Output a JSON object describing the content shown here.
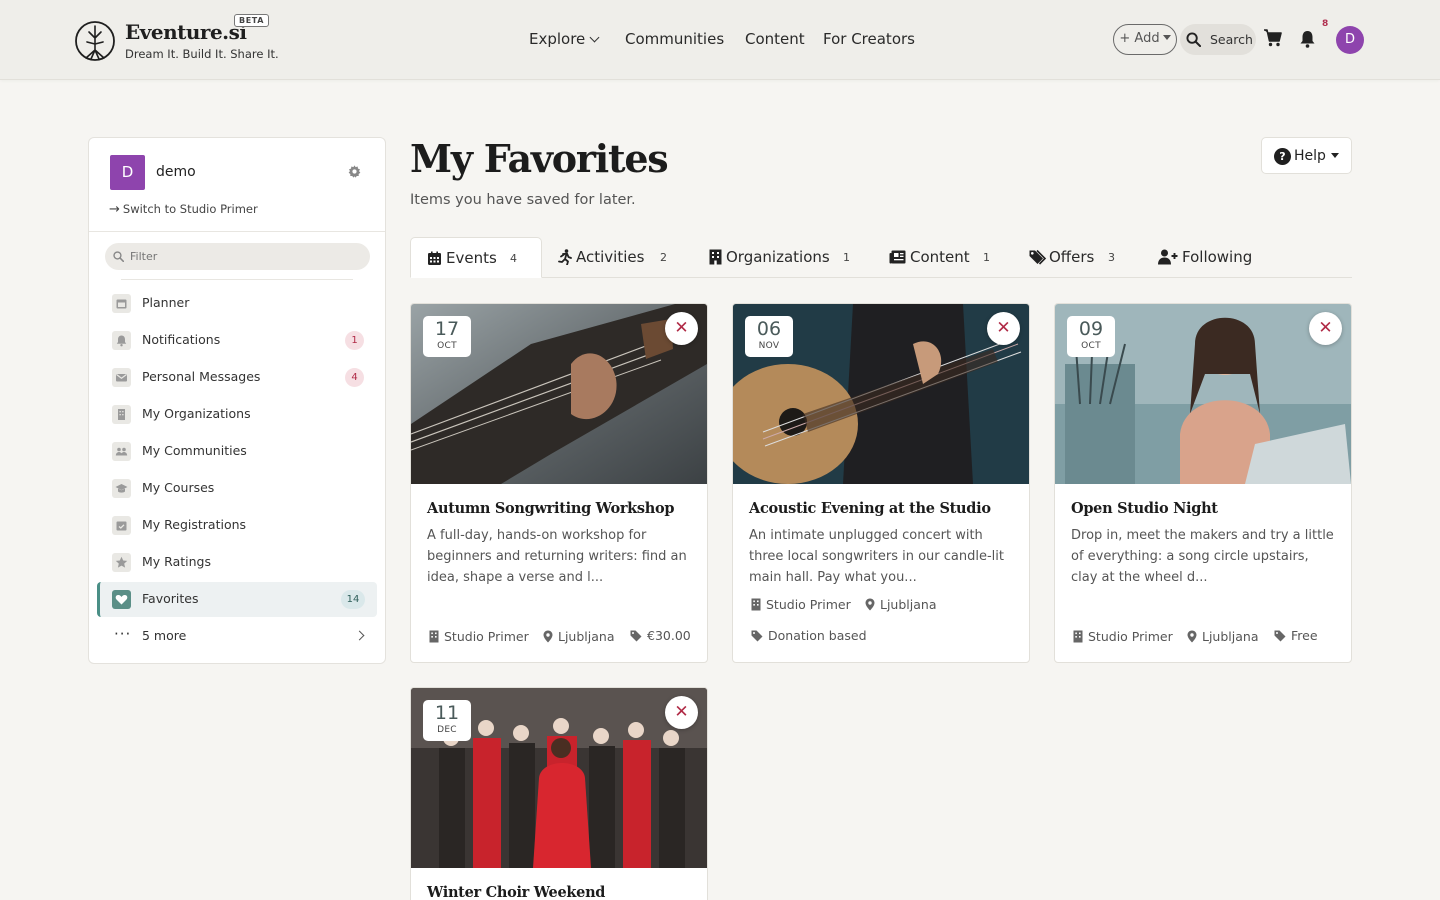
{
  "brand": {
    "name": "Eventure.si",
    "badge": "BETA",
    "tagline": "Dream It. Build It. Share It."
  },
  "nav": {
    "explore": "Explore",
    "communities": "Communities",
    "content": "Content",
    "creators": "For Creators"
  },
  "header_actions": {
    "add_label": "+ Add",
    "search_label": "Search",
    "notification_count": "8",
    "avatar_initial": "D"
  },
  "sidebar": {
    "avatar_initial": "D",
    "username": "demo",
    "switch_label": "Switch to Studio Primer",
    "filter_placeholder": "Filter",
    "items": [
      {
        "label": "Planner",
        "icon": "calendar-icon"
      },
      {
        "label": "Notifications",
        "icon": "bell-icon",
        "badge": "1"
      },
      {
        "label": "Personal Messages",
        "icon": "envelope-icon",
        "badge": "4"
      },
      {
        "label": "My Organizations",
        "icon": "building-icon"
      },
      {
        "label": "My Communities",
        "icon": "users-icon"
      },
      {
        "label": "My Courses",
        "icon": "graduation-cap-icon"
      },
      {
        "label": "My Registrations",
        "icon": "calendar-check-icon"
      },
      {
        "label": "My Ratings",
        "icon": "star-icon"
      },
      {
        "label": "Favorites",
        "icon": "heart-icon",
        "badge": "14",
        "active": true
      }
    ],
    "more_label": "5 more"
  },
  "page": {
    "title": "My Favorites",
    "subtitle": "Items you have saved for later.",
    "help_label": "Help"
  },
  "tabs": [
    {
      "label": "Events",
      "count": "4",
      "active": true
    },
    {
      "label": "Activities",
      "count": "2"
    },
    {
      "label": "Organizations",
      "count": "1"
    },
    {
      "label": "Content",
      "count": "1"
    },
    {
      "label": "Offers",
      "count": "3"
    },
    {
      "label": "Following",
      "count": ""
    }
  ],
  "cards": [
    {
      "day": "17",
      "month": "OCT",
      "title": "Autumn Songwriting Workshop",
      "description": "A full-day, hands-on workshop for beginners and returning writers: find an idea, shape a verse and l...",
      "organizer": "Studio Primer",
      "location": "Ljubljana",
      "price": "€30.00"
    },
    {
      "day": "06",
      "month": "NOV",
      "title": "Acoustic Evening at the Studio",
      "description": "An intimate unplugged concert with three local songwriters in our candle-lit main hall. Pay what you...",
      "organizer": "Studio Primer",
      "location": "Ljubljana",
      "price": "Donation based"
    },
    {
      "day": "09",
      "month": "OCT",
      "title": "Open Studio Night",
      "description": "Drop in, meet the makers and try a little of everything: a song circle upstairs, clay at the wheel d...",
      "organizer": "Studio Primer",
      "location": "Ljubljana",
      "price": "Free"
    },
    {
      "day": "11",
      "month": "DEC",
      "title": "Winter Choir Weekend"
    }
  ],
  "colors": {
    "accent": "#4a8f86",
    "avatar": "#8e44ad",
    "danger": "#b02a46",
    "background": "#f6f5f2"
  }
}
